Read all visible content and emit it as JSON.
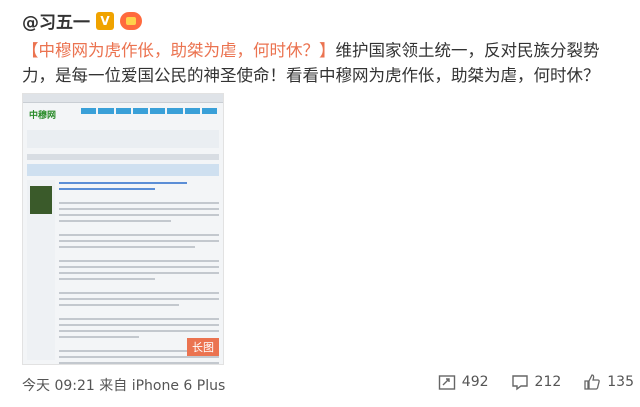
{
  "post": {
    "username": "@习五一",
    "verified_badge": "V",
    "hashtag": "【中穆网为虎作伥，助桀为虐，何时休？】",
    "body": "维护国家领土统一，反对民族分裂势力，是每一位爱国公民的神圣使命！看看中穆网为虎作伥，助桀为虐，何时休？"
  },
  "thumbnail": {
    "logo_text": "中穆网",
    "long_image_label": "长图"
  },
  "footer": {
    "time": "今天 09:21",
    "source": "来自 iPhone 6 Plus"
  },
  "actions": {
    "repost_count": "492",
    "comment_count": "212",
    "like_count": "135"
  },
  "colors": {
    "accent": "#eb7350",
    "badge": "#f0a300"
  },
  "icons": [
    "repost-icon",
    "comment-icon",
    "like-icon"
  ]
}
